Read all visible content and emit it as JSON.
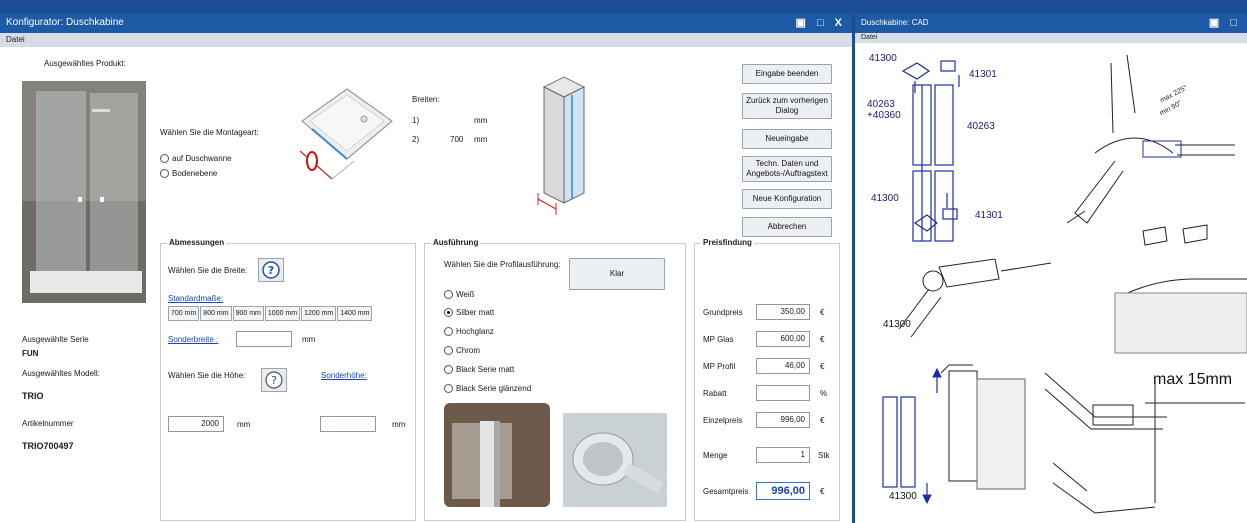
{
  "config_window": {
    "title": "Konfigurator: Duschkabine",
    "controls": "▣ □ X",
    "menu": "Datei",
    "selected_product_label": "Ausgewähltes Produkt:",
    "mount_label": "Wählen Sie die Montageart:",
    "mount_options": [
      "auf Duschwanne",
      "Bodenebene"
    ],
    "widths_label": "Breiten:",
    "width_row1_no": "1)",
    "width_row1_unit": "mm",
    "width_row2_no": "2)",
    "width_row2_value": "700",
    "width_row2_unit": "mm",
    "buttons": {
      "finish": "Eingabe beenden",
      "back": "Zurück zum vorherigen Dialog",
      "new_input": "Neueingabe",
      "tech": "Techn. Daten und Angebots-/Auftragstext",
      "new_config": "Neue Konfiguration",
      "cancel": "Abbrechen"
    },
    "series_label": "Ausgewählte Serie",
    "series_value": "FUN",
    "model_label": "Ausgewähltes Modell:",
    "model_value": "TRIO",
    "article_label": "Artikelnummer",
    "article_value": "TRIO700497",
    "dimensions": {
      "title": "Abmessungen",
      "width_prompt": "Wählen Sie die Breite:",
      "standard_link": "Standardmaße:",
      "sizes": [
        "700 mm",
        "800 mm",
        "900 mm",
        "1000 mm",
        "1200 mm",
        "1400 mm"
      ],
      "special_width_link": "Sonderbreite :",
      "special_width_unit": "mm",
      "height_prompt": "Wählen Sie die Höhe:",
      "special_height_link": "Sonderhöhe:",
      "height_value": "2000",
      "height_unit": "mm",
      "special_height_unit": "mm"
    },
    "finish_section": {
      "title": "Ausführung",
      "prompt": "Wählen Sie die Profilausführung:",
      "glass_button": "Klar",
      "options": [
        "Weiß",
        "Silber matt",
        "Hochglanz",
        "Chrom",
        "Black Serie matt",
        "Black Serie glänzend"
      ],
      "selected_index": 1
    },
    "pricing": {
      "title": "Preisfindung",
      "rows": [
        {
          "label": "Grundpreis",
          "value": "350,00",
          "unit": "€"
        },
        {
          "label": "MP Glas",
          "value": "600,00",
          "unit": "€"
        },
        {
          "label": "MP Profil",
          "value": "46,00",
          "unit": "€"
        },
        {
          "label": "Rabatt",
          "value": "",
          "unit": "%"
        },
        {
          "label": "Einzelpreis",
          "value": "996,00",
          "unit": "€"
        },
        {
          "label": "Menge",
          "value": "1",
          "unit": "Stk"
        },
        {
          "label": "Gesamtpreis",
          "value": "996,00",
          "unit": "€"
        }
      ]
    }
  },
  "cad_window": {
    "title": "Duschkabine: CAD",
    "controls": "▣ □",
    "menu": "Datei",
    "labels": [
      "41300",
      "41301",
      "40263 +40360",
      "40263",
      "41300",
      "41301",
      "41300",
      "41300"
    ],
    "angle_max": "max 225°",
    "angle_min": "min 90°",
    "max_label": "max 15mm"
  },
  "colors": {
    "title_bar": "#1c5aa6",
    "desktop": "#1b4f93",
    "price_total": "#1a44b8"
  }
}
